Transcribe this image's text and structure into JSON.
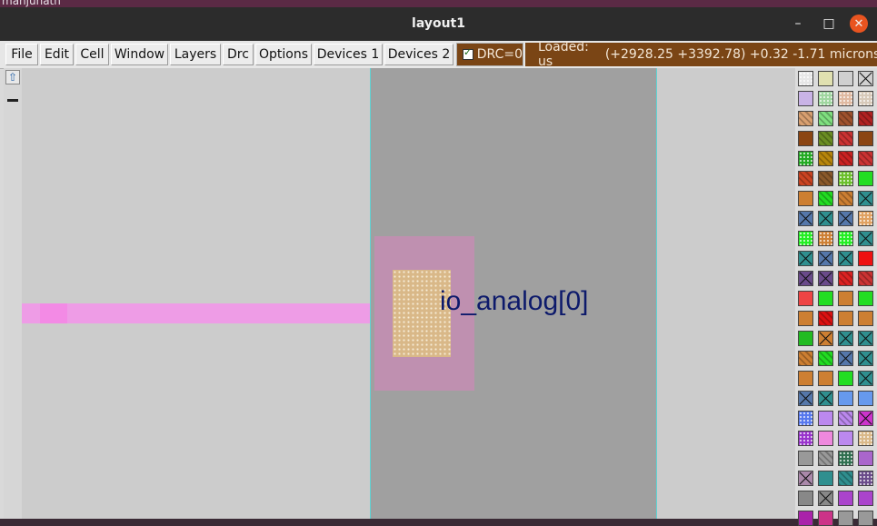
{
  "desktop": {
    "user_text": "manjunath"
  },
  "window": {
    "title": "layout1",
    "controls": {
      "minimize": "–",
      "maximize": "□",
      "close": "✕"
    }
  },
  "menu": {
    "items": [
      "File",
      "Edit",
      "Cell",
      "Window",
      "Layers",
      "Drc",
      "Options",
      "Devices 1",
      "Devices 2"
    ]
  },
  "drc": {
    "label": "DRC=0",
    "checked": true
  },
  "status": {
    "loaded": "Loaded: us",
    "coords": "(+2928.25 +3392.78) +0.32 -1.71 microns"
  },
  "canvas": {
    "pin_label": "io_analog[0]",
    "colors": {
      "background": "#cccccc",
      "wire": "#ee9ce6",
      "pad": "#bf90b0",
      "via": "#d9b888",
      "label": "#0d1a6b",
      "column": "#a0a0a0"
    }
  },
  "palette": {
    "swatches": [
      [
        "#e6e6e6",
        "dots"
      ],
      [
        "#e0e0b0",
        "plain"
      ],
      [
        "#cfcfcf",
        "plain"
      ],
      [
        "#d0d0d0",
        "x"
      ],
      [
        "#c9b3e6",
        "plain"
      ],
      [
        "#9fd69f",
        "dots"
      ],
      [
        "#e0b9a0",
        "dots"
      ],
      [
        "#d7c9b9",
        "dots"
      ],
      [
        "#d9a070",
        "diag"
      ],
      [
        "#7fe07f",
        "diag"
      ],
      [
        "#a0522d",
        "diag"
      ],
      [
        "#b22222",
        "diag"
      ],
      [
        "#8b4513",
        "plain"
      ],
      [
        "#6b8e23",
        "diag"
      ],
      [
        "#cc3333",
        "diag"
      ],
      [
        "#8b4513",
        "plain"
      ],
      [
        "#22aa22",
        "dots"
      ],
      [
        "#b8860b",
        "diag"
      ],
      [
        "#cc2222",
        "diag"
      ],
      [
        "#cc3333",
        "diag"
      ],
      [
        "#cc4422",
        "diag"
      ],
      [
        "#8b5a2b",
        "diag"
      ],
      [
        "#6abf2a",
        "dots"
      ],
      [
        "#22dd22",
        "plain"
      ],
      [
        "#cd7f32",
        "plain"
      ],
      [
        "#22dd22",
        "diag"
      ],
      [
        "#cd7f32",
        "diag"
      ],
      [
        "#2f8f8f",
        "x"
      ],
      [
        "#5577aa",
        "x"
      ],
      [
        "#2f8f8f",
        "x"
      ],
      [
        "#5577aa",
        "x"
      ],
      [
        "#e0a060",
        "dots"
      ],
      [
        "#22ee22",
        "dots"
      ],
      [
        "#cd7f32",
        "dots"
      ],
      [
        "#22ee22",
        "dots"
      ],
      [
        "#2f8f8f",
        "x"
      ],
      [
        "#2f8f8f",
        "x"
      ],
      [
        "#5577aa",
        "x"
      ],
      [
        "#2f8f8f",
        "x"
      ],
      [
        "#ee1111",
        "plain"
      ],
      [
        "#6a4a8a",
        "x"
      ],
      [
        "#6a4a8a",
        "x"
      ],
      [
        "#dd2222",
        "diag"
      ],
      [
        "#cc3333",
        "diag"
      ],
      [
        "#ee4444",
        "plain"
      ],
      [
        "#22dd22",
        "plain"
      ],
      [
        "#cd7f32",
        "plain"
      ],
      [
        "#22dd22",
        "plain"
      ],
      [
        "#cd7f32",
        "plain"
      ],
      [
        "#dd1111",
        "diag"
      ],
      [
        "#cd7f32",
        "plain"
      ],
      [
        "#cd7f32",
        "plain"
      ],
      [
        "#22bb22",
        "plain"
      ],
      [
        "#cd7f32",
        "x"
      ],
      [
        "#2f8f8f",
        "x"
      ],
      [
        "#2f8f8f",
        "x"
      ],
      [
        "#cd7f32",
        "diag"
      ],
      [
        "#22dd22",
        "diag"
      ],
      [
        "#5577aa",
        "x"
      ],
      [
        "#2f8f8f",
        "x"
      ],
      [
        "#cd7f32",
        "plain"
      ],
      [
        "#cd7f32",
        "plain"
      ],
      [
        "#22dd22",
        "plain"
      ],
      [
        "#2f8f8f",
        "x"
      ],
      [
        "#5577aa",
        "x"
      ],
      [
        "#2f8f8f",
        "x"
      ],
      [
        "#6699ee",
        "plain"
      ],
      [
        "#6699ee",
        "plain"
      ],
      [
        "#5577ee",
        "dots"
      ],
      [
        "#bb88ee",
        "plain"
      ],
      [
        "#bb88ee",
        "diag"
      ],
      [
        "#cc33cc",
        "x"
      ],
      [
        "#9933cc",
        "dots"
      ],
      [
        "#ee88dd",
        "plain"
      ],
      [
        "#bb88ee",
        "plain"
      ],
      [
        "#d9b888",
        "dots"
      ],
      [
        "#999999",
        "plain"
      ],
      [
        "#999999",
        "diag"
      ],
      [
        "#2f6f4f",
        "dots"
      ],
      [
        "#aa66cc",
        "plain"
      ],
      [
        "#aa88aa",
        "x"
      ],
      [
        "#2f8f8f",
        "plain"
      ],
      [
        "#2f8f8f",
        "diag"
      ],
      [
        "#6a4a8a",
        "dots"
      ],
      [
        "#888888",
        "plain"
      ],
      [
        "#888888",
        "x"
      ],
      [
        "#aa44cc",
        "plain"
      ],
      [
        "#aa44cc",
        "plain"
      ],
      [
        "#aa22aa",
        "plain"
      ],
      [
        "#cc3388",
        "plain"
      ],
      [
        "#999999",
        "plain"
      ],
      [
        "#999999",
        "plain"
      ]
    ]
  }
}
